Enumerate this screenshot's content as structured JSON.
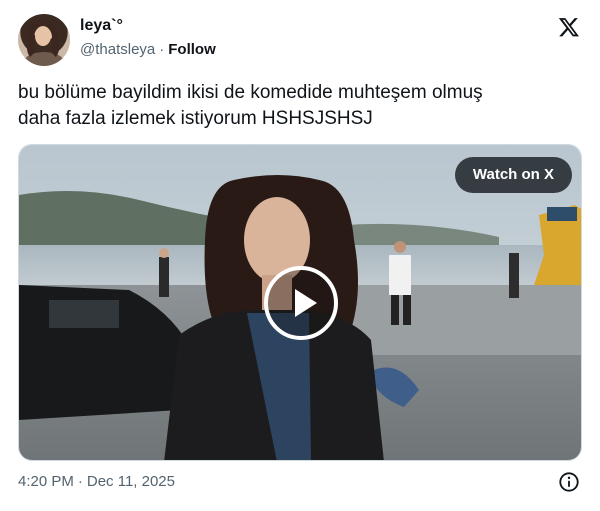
{
  "author": {
    "display_name": "leya`°",
    "handle": "@thatsleya",
    "separator": "·",
    "follow_label": "Follow",
    "avatar_icon": "profile-photo"
  },
  "brand_icon": "x-logo-icon",
  "tweet": {
    "text_line_1": "bu bölüme bayildim ikisi de komedide muhteşem olmuş",
    "text_line_2": "daha fazla izlemek istiyorum HSHSJSHSJ"
  },
  "media": {
    "watch_label": "Watch on X",
    "play_icon": "play-icon"
  },
  "footer": {
    "time": "4:20 PM",
    "separator": "·",
    "date": "Dec 11, 2025",
    "info_icon": "info-icon"
  },
  "colors": {
    "text_primary": "#0f1419",
    "text_secondary": "#536471",
    "border": "#cfd9de",
    "pill_bg": "#0f1419"
  }
}
